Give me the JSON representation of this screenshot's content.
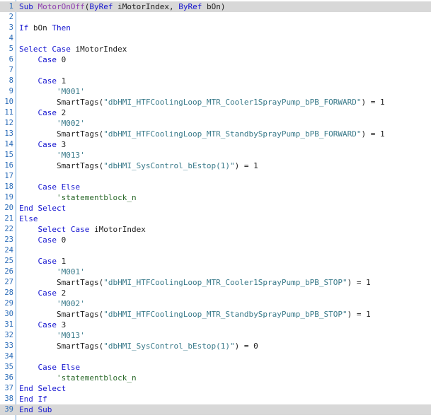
{
  "editor": {
    "language": "VBScript",
    "highlighted_lines": [
      1,
      39
    ],
    "colors": {
      "keyword": "#1515d0",
      "function_name": "#8f3fb0",
      "string": "#3a7a8a",
      "comment": "#2c6a2c",
      "text": "#1f1f1f",
      "line_number": "#2b6cb8",
      "highlight": "#d8d8d8"
    },
    "lines": [
      {
        "n": "1",
        "tokens": [
          {
            "t": "kw",
            "v": "Sub "
          },
          {
            "t": "fn",
            "v": "MotorOnOff"
          },
          {
            "t": "id",
            "v": "("
          },
          {
            "t": "kw",
            "v": "ByRef"
          },
          {
            "t": "id",
            "v": " iMotorIndex, "
          },
          {
            "t": "kw",
            "v": "ByRef"
          },
          {
            "t": "id",
            "v": " bOn)"
          }
        ]
      },
      {
        "n": "2",
        "tokens": []
      },
      {
        "n": "3",
        "tokens": [
          {
            "t": "kw",
            "v": "If"
          },
          {
            "t": "id",
            "v": " bOn "
          },
          {
            "t": "kw",
            "v": "Then"
          }
        ]
      },
      {
        "n": "4",
        "tokens": []
      },
      {
        "n": "5",
        "tokens": [
          {
            "t": "kw",
            "v": "Select Case"
          },
          {
            "t": "id",
            "v": " iMotorIndex"
          }
        ]
      },
      {
        "n": "6",
        "tokens": [
          {
            "t": "id",
            "v": "    "
          },
          {
            "t": "kw",
            "v": "Case"
          },
          {
            "t": "id",
            "v": " 0"
          }
        ]
      },
      {
        "n": "7",
        "tokens": []
      },
      {
        "n": "8",
        "tokens": [
          {
            "t": "id",
            "v": "    "
          },
          {
            "t": "kw",
            "v": "Case"
          },
          {
            "t": "id",
            "v": " 1"
          }
        ]
      },
      {
        "n": "9",
        "tokens": [
          {
            "t": "id",
            "v": "        "
          },
          {
            "t": "str",
            "v": "'M001'"
          }
        ]
      },
      {
        "n": "10",
        "tokens": [
          {
            "t": "id",
            "v": "        SmartTags("
          },
          {
            "t": "str",
            "v": "\"dbHMI_HTFCoolingLoop_MTR_Cooler1SprayPump_bPB_FORWARD\""
          },
          {
            "t": "id",
            "v": ") = 1"
          }
        ]
      },
      {
        "n": "11",
        "tokens": [
          {
            "t": "id",
            "v": "    "
          },
          {
            "t": "kw",
            "v": "Case"
          },
          {
            "t": "id",
            "v": " 2"
          }
        ]
      },
      {
        "n": "12",
        "tokens": [
          {
            "t": "id",
            "v": "        "
          },
          {
            "t": "str",
            "v": "'M002'"
          }
        ]
      },
      {
        "n": "13",
        "tokens": [
          {
            "t": "id",
            "v": "        SmartTags("
          },
          {
            "t": "str",
            "v": "\"dbHMI_HTFCoolingLoop_MTR_StandbySprayPump_bPB_FORWARD\""
          },
          {
            "t": "id",
            "v": ") = 1"
          }
        ]
      },
      {
        "n": "14",
        "tokens": [
          {
            "t": "id",
            "v": "    "
          },
          {
            "t": "kw",
            "v": "Case"
          },
          {
            "t": "id",
            "v": " 3"
          }
        ]
      },
      {
        "n": "15",
        "tokens": [
          {
            "t": "id",
            "v": "        "
          },
          {
            "t": "str",
            "v": "'M013'"
          }
        ]
      },
      {
        "n": "16",
        "tokens": [
          {
            "t": "id",
            "v": "        SmartTags("
          },
          {
            "t": "str",
            "v": "\"dbHMI_SysControl_bEstop(1)\""
          },
          {
            "t": "id",
            "v": ") = 1"
          }
        ]
      },
      {
        "n": "17",
        "tokens": []
      },
      {
        "n": "18",
        "tokens": [
          {
            "t": "id",
            "v": "    "
          },
          {
            "t": "kw",
            "v": "Case Else"
          }
        ]
      },
      {
        "n": "19",
        "tokens": [
          {
            "t": "id",
            "v": "        "
          },
          {
            "t": "cm",
            "v": "'statementblock_n"
          }
        ]
      },
      {
        "n": "20",
        "tokens": [
          {
            "t": "kw",
            "v": "End Select"
          }
        ]
      },
      {
        "n": "21",
        "tokens": [
          {
            "t": "kw",
            "v": "Else"
          }
        ]
      },
      {
        "n": "22",
        "tokens": [
          {
            "t": "id",
            "v": "    "
          },
          {
            "t": "kw",
            "v": "Select Case"
          },
          {
            "t": "id",
            "v": " iMotorIndex"
          }
        ]
      },
      {
        "n": "23",
        "tokens": [
          {
            "t": "id",
            "v": "    "
          },
          {
            "t": "kw",
            "v": "Case"
          },
          {
            "t": "id",
            "v": " 0"
          }
        ]
      },
      {
        "n": "24",
        "tokens": []
      },
      {
        "n": "25",
        "tokens": [
          {
            "t": "id",
            "v": "    "
          },
          {
            "t": "kw",
            "v": "Case"
          },
          {
            "t": "id",
            "v": " 1"
          }
        ]
      },
      {
        "n": "26",
        "tokens": [
          {
            "t": "id",
            "v": "        "
          },
          {
            "t": "str",
            "v": "'M001'"
          }
        ]
      },
      {
        "n": "27",
        "tokens": [
          {
            "t": "id",
            "v": "        SmartTags("
          },
          {
            "t": "str",
            "v": "\"dbHMI_HTFCoolingLoop_MTR_Cooler1SprayPump_bPB_STOP\""
          },
          {
            "t": "id",
            "v": ") = 1"
          }
        ]
      },
      {
        "n": "28",
        "tokens": [
          {
            "t": "id",
            "v": "    "
          },
          {
            "t": "kw",
            "v": "Case"
          },
          {
            "t": "id",
            "v": " 2"
          }
        ]
      },
      {
        "n": "29",
        "tokens": [
          {
            "t": "id",
            "v": "        "
          },
          {
            "t": "str",
            "v": "'M002'"
          }
        ]
      },
      {
        "n": "30",
        "tokens": [
          {
            "t": "id",
            "v": "        SmartTags("
          },
          {
            "t": "str",
            "v": "\"dbHMI_HTFCoolingLoop_MTR_StandbySprayPump_bPB_STOP\""
          },
          {
            "t": "id",
            "v": ") = 1"
          }
        ]
      },
      {
        "n": "31",
        "tokens": [
          {
            "t": "id",
            "v": "    "
          },
          {
            "t": "kw",
            "v": "Case"
          },
          {
            "t": "id",
            "v": " 3"
          }
        ]
      },
      {
        "n": "32",
        "tokens": [
          {
            "t": "id",
            "v": "        "
          },
          {
            "t": "str",
            "v": "'M013'"
          }
        ]
      },
      {
        "n": "33",
        "tokens": [
          {
            "t": "id",
            "v": "        SmartTags("
          },
          {
            "t": "str",
            "v": "\"dbHMI_SysControl_bEstop(1)\""
          },
          {
            "t": "id",
            "v": ") = 0"
          }
        ]
      },
      {
        "n": "34",
        "tokens": []
      },
      {
        "n": "35",
        "tokens": [
          {
            "t": "id",
            "v": "    "
          },
          {
            "t": "kw",
            "v": "Case Else"
          }
        ]
      },
      {
        "n": "36",
        "tokens": [
          {
            "t": "id",
            "v": "        "
          },
          {
            "t": "cm",
            "v": "'statementblock_n"
          }
        ]
      },
      {
        "n": "37",
        "tokens": [
          {
            "t": "kw",
            "v": "End Select"
          }
        ]
      },
      {
        "n": "38",
        "tokens": [
          {
            "t": "kw",
            "v": "End If"
          }
        ]
      },
      {
        "n": "39",
        "tokens": [
          {
            "t": "kw",
            "v": "End Sub"
          }
        ]
      }
    ]
  }
}
